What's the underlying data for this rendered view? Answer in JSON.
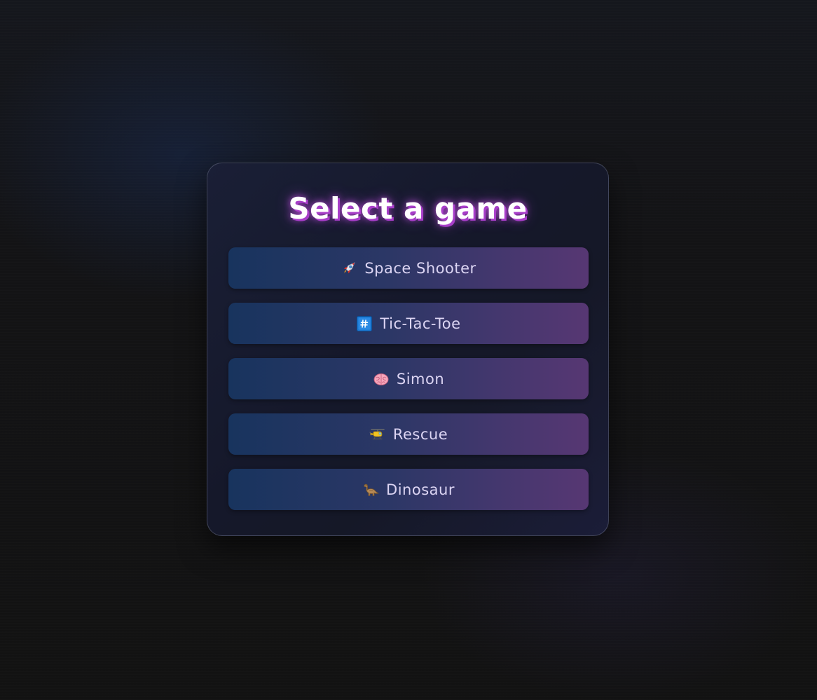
{
  "menu": {
    "title": "Select a game",
    "games": [
      {
        "label": "Space Shooter",
        "icon": "rocket-icon"
      },
      {
        "label": "Tic-Tac-Toe",
        "icon": "hash-keycap-icon"
      },
      {
        "label": "Simon",
        "icon": "brain-icon"
      },
      {
        "label": "Rescue",
        "icon": "helicopter-icon"
      },
      {
        "label": "Dinosaur",
        "icon": "dinosaur-icon"
      }
    ]
  },
  "colors": {
    "title_glow": "#a83ec9",
    "button_gradient_start": "#18345e",
    "button_gradient_end": "#573773",
    "button_text": "#dcd5f3"
  }
}
